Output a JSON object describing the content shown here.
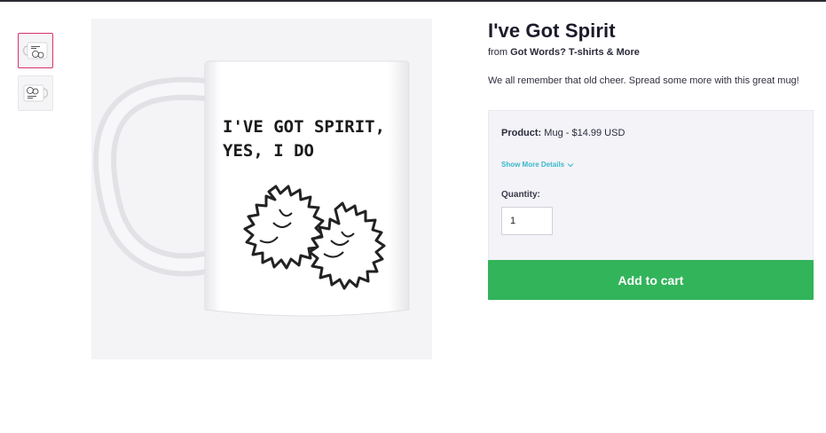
{
  "product": {
    "title": "I've Got Spirit",
    "from_prefix": "from ",
    "store_name": "Got Words? T-shirts & More",
    "description": "We all remember that old cheer. Spread some more with this great mug!",
    "image_text_line1": "I'VE GOT SPIRIT,",
    "image_text_line2": "YES, I DO"
  },
  "options": {
    "product_label": "Product:",
    "product_value": " Mug - $14.99 USD",
    "show_more": "Show More Details",
    "quantity_label": "Quantity:",
    "quantity_value": "1"
  },
  "actions": {
    "add_to_cart": "Add to cart"
  },
  "colors": {
    "accent_green": "#32b45a",
    "link_teal": "#3bb8c9",
    "selected_thumb": "#d6336c"
  }
}
